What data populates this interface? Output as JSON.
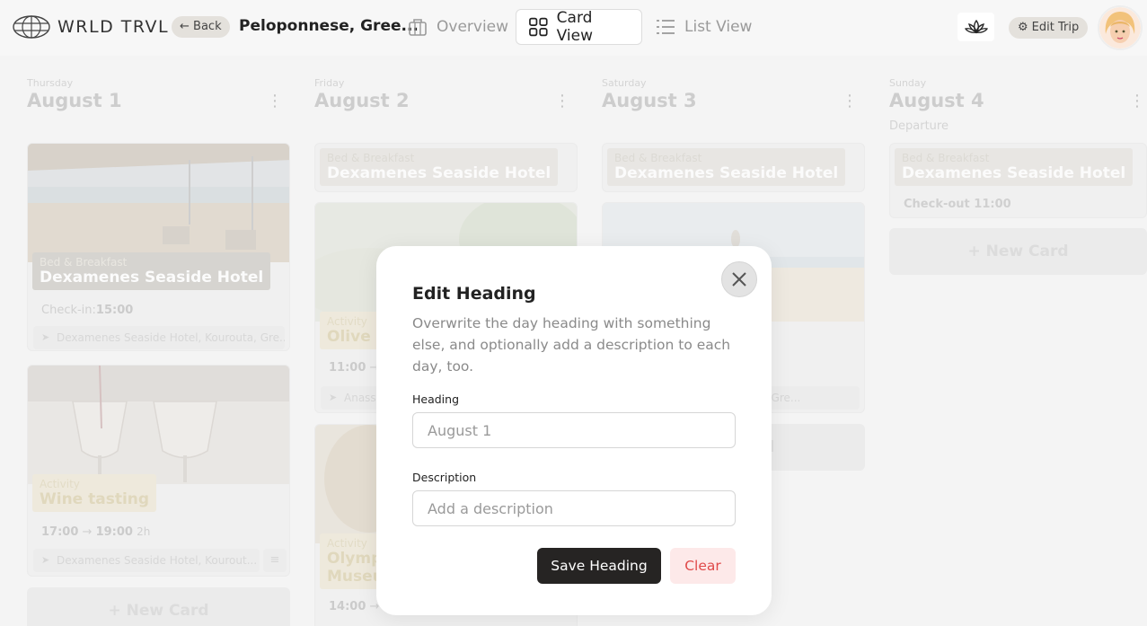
{
  "header": {
    "logo_text": "WRLD TRVL",
    "back_label": "Back",
    "trip_title": "Peloponnese, Gree...",
    "tabs": [
      {
        "label": "Overview",
        "active": false
      },
      {
        "label": "Card View",
        "active": true
      },
      {
        "label": "List View",
        "active": false
      }
    ],
    "edit_trip_label": "Edit Trip"
  },
  "days": [
    {
      "weekday": "Thursday",
      "title": "August 1",
      "description": "",
      "hotel": {
        "type": "Bed & Breakfast",
        "name": "Dexamenes Seaside Hotel",
        "checkin_label": "Check-in:",
        "checkin_time": "15:00",
        "location": "Dexamenes Seaside Hotel, Kourouta, Gre..."
      },
      "activity": {
        "type": "Activity",
        "name": "Wine tasting",
        "start": "17:00",
        "end": "19:00",
        "duration": "2h",
        "location": "Dexamenes Seaside Hotel, Kourout..."
      },
      "new_card": "+ New Card"
    },
    {
      "weekday": "Friday",
      "title": "August 2",
      "hotel": {
        "type": "Bed & Breakfast",
        "name": "Dexamenes Seaside Hotel"
      },
      "activity1": {
        "type": "Activity",
        "name": "Olive O",
        "start": "11:00",
        "location": "Anass"
      },
      "activity2": {
        "type": "Activity",
        "name_line1": "Olympi",
        "name_line2": "Museu",
        "start": "14:00"
      }
    },
    {
      "weekday": "Saturday",
      "title": "August 3",
      "hotel": {
        "type": "Bed & Breakfast",
        "name": "Dexamenes Seaside Hotel"
      },
      "location": "Kourouta, Gre...",
      "new_card_partial": "d"
    },
    {
      "weekday": "Sunday",
      "title": "August 4",
      "description": "Departure",
      "hotel": {
        "type": "Bed & Breakfast",
        "name": "Dexamenes Seaside Hotel",
        "checkout": "Check-out 11:00"
      },
      "new_card": "+ New Card"
    }
  ],
  "modal": {
    "title": "Edit Heading",
    "subtitle": "Overwrite the day heading with something else, and optionally add a description to each day, too.",
    "heading_label": "Heading",
    "heading_placeholder": "August 1",
    "description_label": "Description",
    "description_placeholder": "Add a description",
    "save_label": "Save Heading",
    "clear_label": "Clear"
  },
  "colors": {
    "primary_button": "#262423",
    "danger": "#e04a4a",
    "danger_bg": "#fde9e9"
  }
}
